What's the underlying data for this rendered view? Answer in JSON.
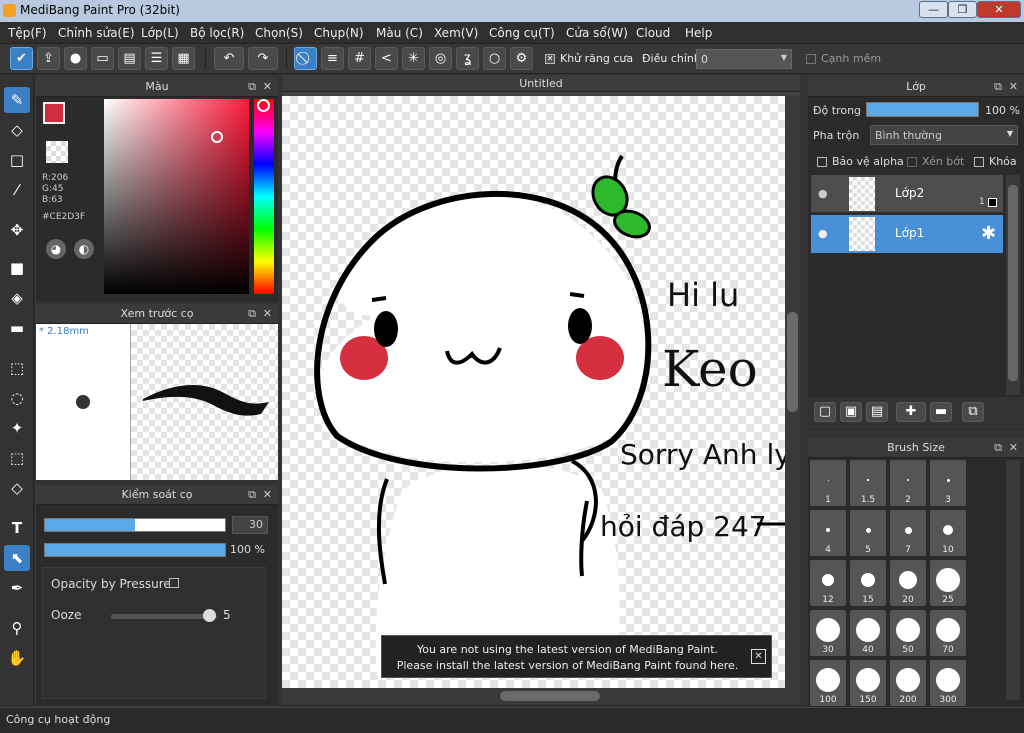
{
  "window": {
    "title": "MediBang Paint Pro (32bit)",
    "minimize": "—",
    "restore": "❐",
    "close": "✕"
  },
  "menu": [
    "Tệp(F)",
    "Chỉnh sửa(E)",
    "Lớp(L)",
    "Bộ lọc(R)",
    "Chọn(S)",
    "Chụp(N)",
    "Màu (C)",
    "Xem(V)",
    "Công cụ(T)",
    "Cửa sổ(W)",
    "Cloud",
    "Help"
  ],
  "toolbar": {
    "antialias_label": "Khử răng cưa",
    "adjust_label": "Điều chỉnh",
    "adjust_value": "0",
    "soft_edge_label": "Cạnh mềm"
  },
  "color_panel": {
    "title": "Màu",
    "r": "R:206",
    "g": "G:45",
    "b": "B:63",
    "hex": "#CE2D3F",
    "current_color": "#ce2d3f"
  },
  "brush_preview_panel": {
    "title": "Xem trước cọ",
    "size": "* 2.18mm"
  },
  "brush_control_panel": {
    "title": "Kiểm soát cọ",
    "width_value": "30",
    "width_fill": 0.5,
    "opacity_value": "100 %",
    "opacity_fill": 1.0,
    "opacity_pressure_label": "Opacity by Pressure",
    "ooze_label": "Ooze",
    "ooze_value": "5"
  },
  "canvas": {
    "tab_title": "Untitled",
    "drawn_texts": [
      "Hi lu",
      "Keo",
      "Sorry Anh ly",
      "hỏi đáp 247"
    ]
  },
  "notification": {
    "line1": "You are not using the latest version of MediBang Paint.",
    "line2": "Please install the latest version of MediBang Paint found here.",
    "close": "✕"
  },
  "layer_panel": {
    "title": "Lớp",
    "opacity_label": "Độ trong",
    "opacity_value": "100 %",
    "blend_label": "Pha trộn",
    "blend_value": "Bình thường",
    "protect_alpha": "Bảo vệ alpha",
    "clipping": "Xén bớt",
    "lock": "Khóa",
    "layers": [
      {
        "name": "Lớp2",
        "badge": "1"
      },
      {
        "name": "Lớp1"
      }
    ]
  },
  "brush_size_panel": {
    "title": "Brush Size",
    "sizes": [
      "1",
      "1.5",
      "2",
      "3",
      "4",
      "5",
      "7",
      "10",
      "12",
      "15",
      "20",
      "25",
      "30",
      "40",
      "50",
      "70",
      "100",
      "150",
      "200",
      "300"
    ]
  },
  "status": {
    "text": "Công cụ hoạt động"
  },
  "colors": {
    "accent": "#3b7fc4",
    "selected_layer": "#4a90d9",
    "leaf": "#2db82d",
    "cheek": "#d63040"
  }
}
